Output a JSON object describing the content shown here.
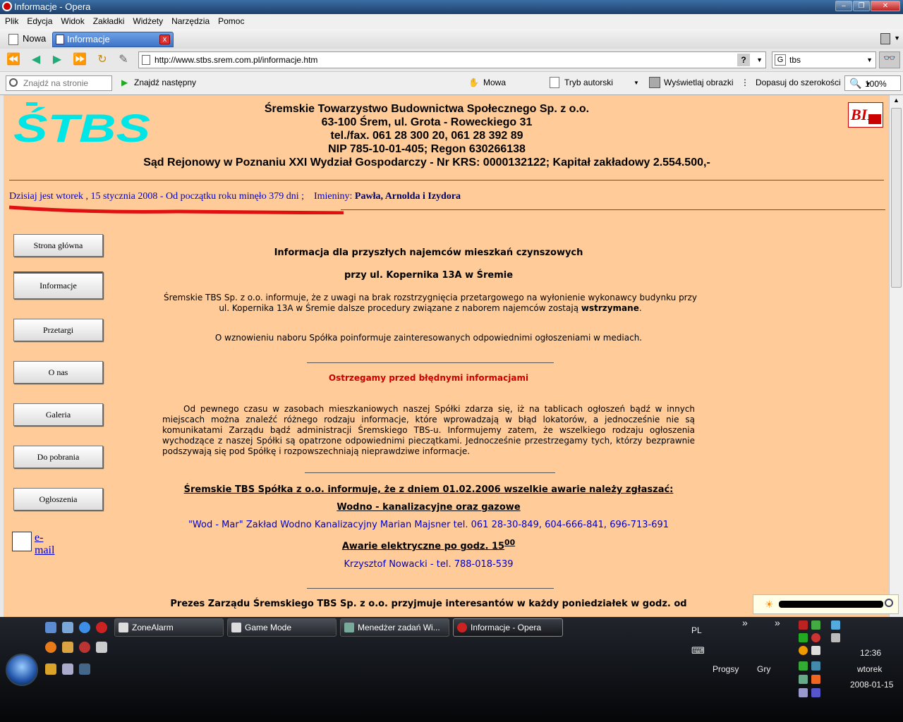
{
  "window": {
    "title": "Informacje - Opera"
  },
  "menu": [
    "Plik",
    "Edycja",
    "Widok",
    "Zakładki",
    "Widżety",
    "Narzędzia",
    "Pomoc"
  ],
  "tabs": {
    "new_label": "Nowa",
    "active_label": "Informacje"
  },
  "address": {
    "url": "http://www.stbs.srem.com.pl/informacje.htm",
    "help": "?"
  },
  "search": {
    "engine_icon": "G",
    "value": "tbs"
  },
  "findbar": {
    "find_placeholder": "Znajdź na stronie",
    "find_next": "Znajdź następny",
    "voice": "Mowa",
    "author_mode": "Tryb autorski",
    "show_images": "Wyświetlaj obrazki",
    "fit_width": "Dopasuj do szerokości",
    "zoom": "100%"
  },
  "site": {
    "logo_text": "ŚTBS",
    "header_lines": [
      "Śremskie Towarzystwo Budownictwa Społecznego Sp. z o.o.",
      "63-100 Śrem, ul. Grota - Roweckiego 31",
      "tel./fax.  061 28 300 20, 061 28 392 89",
      "NIP 785-10-01-405; Regon 630266138",
      "Sąd Rejonowy w Poznaniu XXI Wydział Gospodarczy - Nr KRS: 0000132122; Kapitał zakładowy 2.554.500,-"
    ],
    "bip_label": "BIP",
    "dateline": "Dzisiaj jest wtorek , 15 stycznia 2008 - Od początku roku minęło 379 dni ;",
    "namedays_prefix": "Imieniny:",
    "namedays": "Pawła, Arnolda i Izydora"
  },
  "nav": [
    "Strona główna",
    "Informacje",
    "Przetargi",
    "O nas",
    "Galeria",
    "Do pobrania",
    "Ogłoszenia"
  ],
  "email_label": "e-mail",
  "content": {
    "heading1": "Informacja dla przyszłych najemców mieszkań czynszowych",
    "heading2": "przy ul. Kopernika 13A w Śremie",
    "para1_a": "Śremskie TBS Sp. z o.o. informuje, że z uwagi na brak rozstrzygnięcia przetargowego na wyłonienie wykonawcy budynku przy ul. Kopernika 13A w Śremie dalsze procedury związane z naborem najemców zostają ",
    "para1_b": "wstrzymane",
    "para1_c": ".",
    "para2": "O wznowieniu naboru Spółka poinformuje zainteresowanych odpowiednimi ogłoszeniami w mediach.",
    "warning": "Ostrzegamy przed błędnymi informacjami",
    "para3": "Od pewnego czasu w zasobach mieszkaniowych naszej Spółki zdarza się, iż na tablicach ogłoszeń bądź w innych miejscach można znaleźć różnego rodzaju informacje, które wprowadzają w błąd lokatorów, a jednocześnie nie są komunikatami Zarządu bądź administracji Śremskiego TBS-u. Informujemy zatem, że wszelkiego rodzaju ogłoszenia wychodzące z naszej Spółki są opatrzone odpowiednimi pieczątkami. Jednocześnie przestrzegamy tych, którzy bezprawnie podszywają się pod Spółkę i rozpowszechniają nieprawdziwe informacje.",
    "heading3": "Śremskie TBS Spółka z o.o. informuje, że z dniem 01.02.2006 wszelkie awarie  należy zgłaszać:",
    "heading4": "Wodno - kanalizacyjne oraz gazowe",
    "contact1": "\"Wod - Mar\" Zakład Wodno Kanalizacyjny Marian Majsner tel. 061 28-30-849, 604-666-841, 696-713-691",
    "heading5": "Awarie elektryczne po godz. 15",
    "heading5_sup": "00",
    "contact2": "Krzysztof Nowacki -  tel. 788-018-539",
    "heading6": "Prezes Zarządu Śremskiego TBS Sp. z o.o.  przyjmuje interesantów w każdy poniedziałek w godz. od"
  },
  "taskbar": {
    "buttons": [
      "ZoneAlarm",
      "Game Mode",
      "Menedżer zadań Wi...",
      "Informacje - Opera"
    ],
    "lang": "PL",
    "chevron": "»",
    "toolbar_items": [
      "Progsy",
      "Gry"
    ],
    "time": "12:36",
    "day": "wtorek",
    "date": "2008-01-15"
  },
  "colors": {
    "page_bg": "#ffcc99",
    "link_blue": "#0000cc",
    "warning_red": "#cc0000",
    "logo_cyan": "#00e5e5"
  }
}
